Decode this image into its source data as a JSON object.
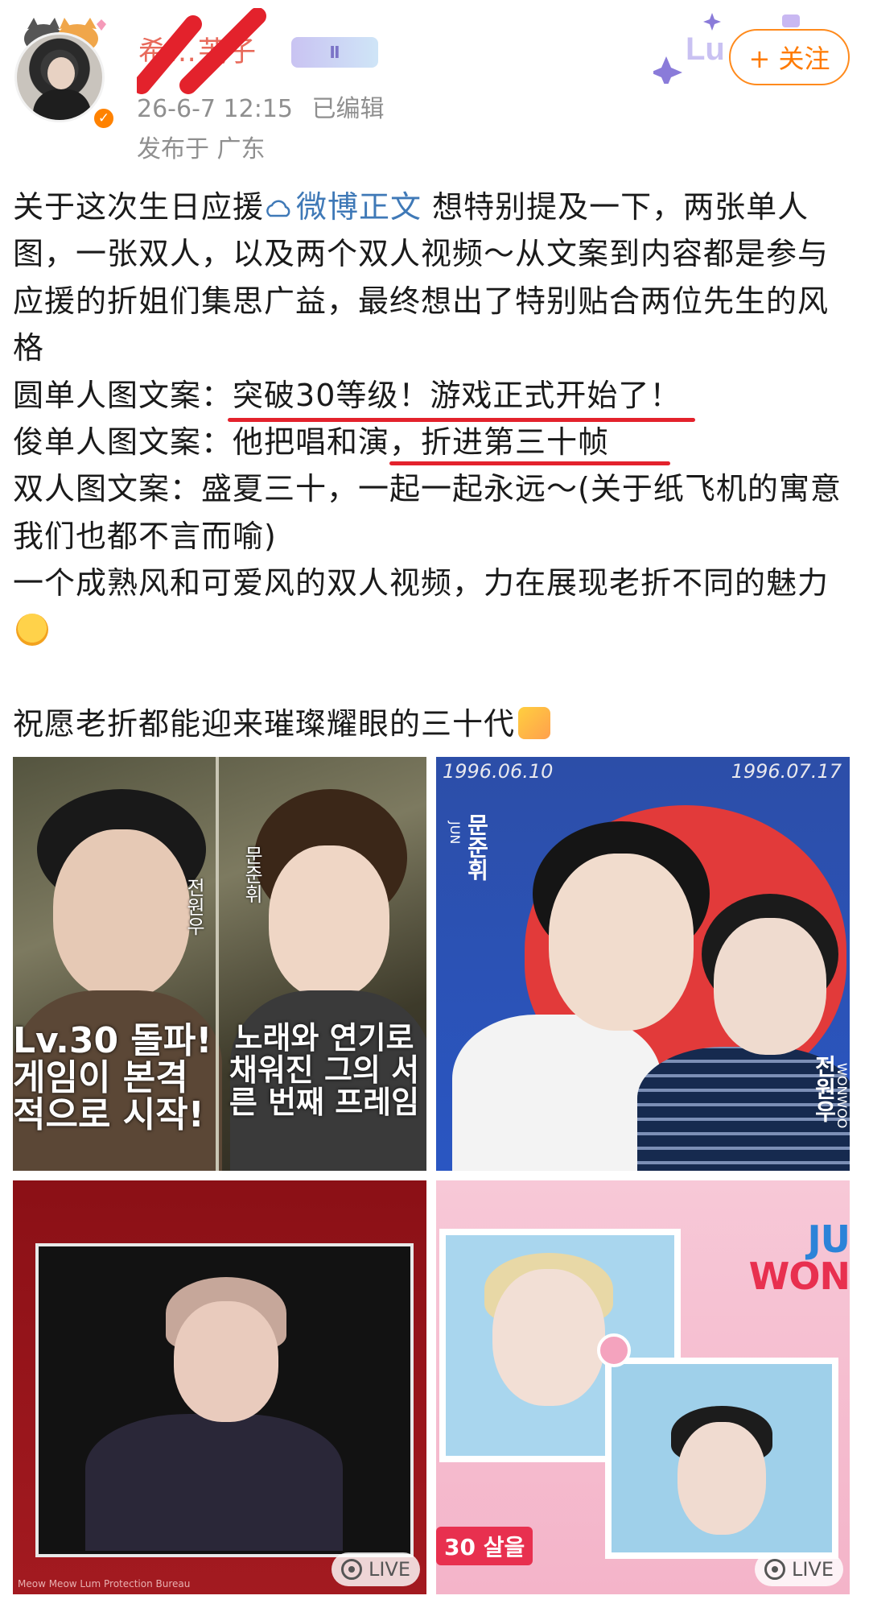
{
  "header": {
    "username": "希…芙子",
    "level_badge": "Ⅱ",
    "follow_label": "+ 关注",
    "timestamp": "26-6-7 12:15",
    "edited": "已编辑",
    "location": "发布于 广东",
    "deco_text": "Lu"
  },
  "post": {
    "p1_a": "关于这次生日应援",
    "topic_link": "微博正文",
    "p1_b": " 想特别提及一下，两张单人图，一张双人，以及两个双人视频～从文案到内容都是参与应援的折姐们集思广益，最终想出了特别贴合两位先生的风格",
    "p2_a": "圆单人图文案：",
    "p2_u": "突破30等级！游戏正式开始了！",
    "p3_a": "俊单人图文案：他把唱和演",
    "p3_u": "，折进第三十帧",
    "p4": "双人图文案：盛夏三十，一起一起永远～(关于纸飞机的寓意我们也都不言而喻)",
    "p5": "一个成熟风和可爱风的双人视频，力在展现老折不同的魅力",
    "p6": "祝愿老折都能迎来璀璨耀眼的三十代"
  },
  "images": {
    "t1_left_text": "Lv.30 돌파! 게임이 본격적으로 시작!",
    "t1_right_text": "노래와 연기로 채워진 그의 서른 번째 프레임",
    "t1_name_left": "전원우",
    "t1_name_right": "문준휘",
    "t2_date_left": "1996.06.10",
    "t2_date_right": "1996.07.17",
    "t2_name_left": "문준휘",
    "t2_sub_left": "JUN",
    "t2_name_right": "전원우",
    "t2_sub_right": "WONWOO",
    "t3_caption": "Meow Meow Lum Protection Bureau",
    "t4_brand_top": "JU",
    "t4_brand_bottom": "WON",
    "t4_sticker": "30 살을",
    "live_label": "LIVE"
  },
  "colors": {
    "brand_orange": "#ff8200",
    "link_blue": "#3f79b7",
    "underline_red": "#e3222c",
    "meta_gray": "#8f8f8f"
  }
}
